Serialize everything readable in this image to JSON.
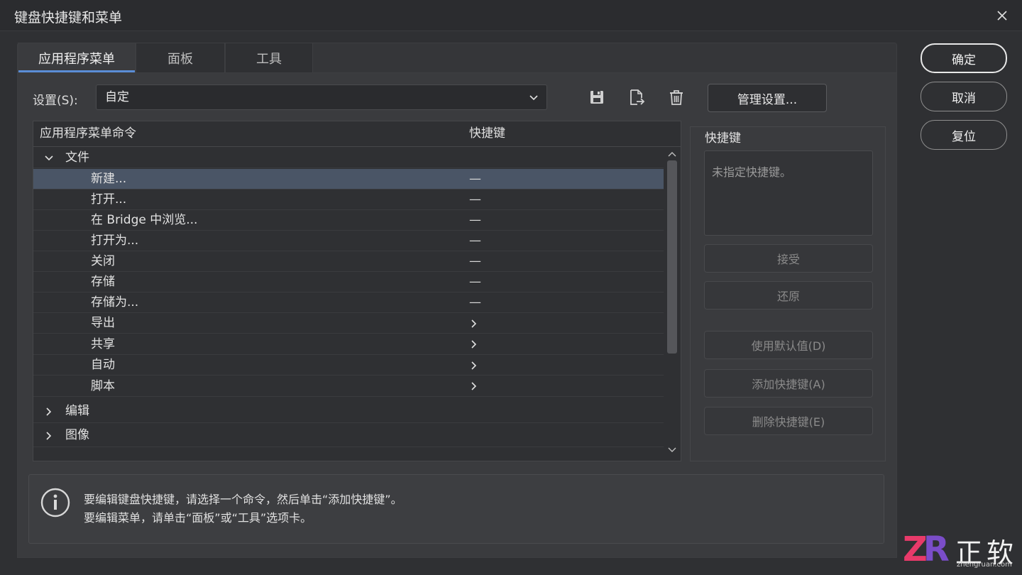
{
  "window": {
    "title": "键盘快捷键和菜单"
  },
  "tabs": [
    {
      "label": "应用程序菜单",
      "active": true
    },
    {
      "label": "面板",
      "active": false
    },
    {
      "label": "工具",
      "active": false
    }
  ],
  "settings": {
    "label": "设置(S):",
    "value": "自定",
    "manage_label": "管理设置..."
  },
  "table": {
    "col_command": "应用程序菜单命令",
    "col_shortcut": "快捷键",
    "rows": [
      {
        "label": "文件",
        "level": 0,
        "expanded": true
      },
      {
        "label": "新建...",
        "level": 1,
        "shortcut": "—",
        "selected": true
      },
      {
        "label": "打开...",
        "level": 1,
        "shortcut": "—"
      },
      {
        "label": "在 Bridge 中浏览...",
        "level": 1,
        "shortcut": "—"
      },
      {
        "label": "打开为...",
        "level": 1,
        "shortcut": "—"
      },
      {
        "label": "关闭",
        "level": 1,
        "shortcut": "—"
      },
      {
        "label": "存储",
        "level": 1,
        "shortcut": "—"
      },
      {
        "label": "存储为...",
        "level": 1,
        "shortcut": "—"
      },
      {
        "label": "导出",
        "level": 1,
        "submenu": true
      },
      {
        "label": "共享",
        "level": 1,
        "submenu": true
      },
      {
        "label": "自动",
        "level": 1,
        "submenu": true
      },
      {
        "label": "脚本",
        "level": 1,
        "submenu": true
      },
      {
        "label": "编辑",
        "level": 0,
        "expanded": false
      },
      {
        "label": "图像",
        "level": 0,
        "expanded": false
      }
    ]
  },
  "shortcut_panel": {
    "title": "快捷键",
    "placeholder": "未指定快捷键。",
    "accept": "接受",
    "revert": "还原",
    "use_default": "使用默认值(D)",
    "add_shortcut": "添加快捷键(A)",
    "delete_shortcut": "删除快捷键(E)"
  },
  "info": {
    "line1": "要编辑键盘快捷键，请选择一个命令，然后单击“添加快捷键”。",
    "line2": "要编辑菜单，请单击“面板”或“工具”选项卡。"
  },
  "buttons": {
    "ok": "确定",
    "cancel": "取消",
    "reset": "复位"
  },
  "watermark": {
    "logo": "ZR",
    "name": "正软",
    "url": "zhengruan.com"
  },
  "colors": {
    "accent": "#5a8dd6",
    "selected_row": "#4a5566",
    "logo_z": "#e83a6a",
    "logo_r": "#7a4dc8"
  }
}
